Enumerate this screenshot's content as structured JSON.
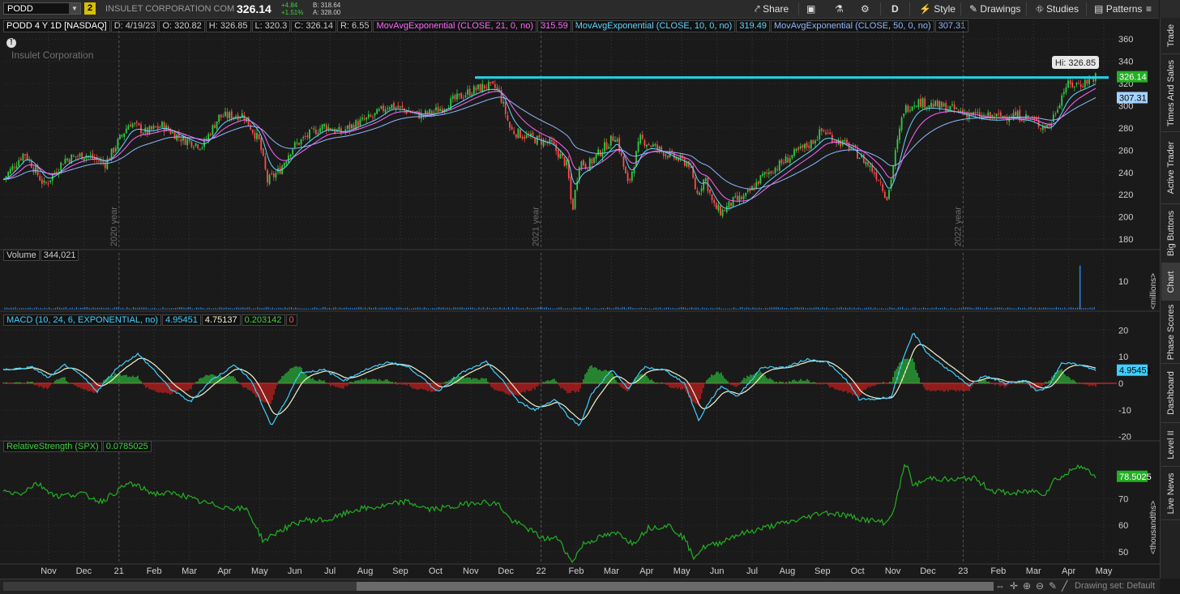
{
  "toolbar": {
    "symbol": "PODD",
    "link_number": "2",
    "company": "INSULET CORPORATION COM",
    "last": "326.14",
    "change": "+4.84",
    "change_pct": "+1.51%",
    "bid": "B: 318.64",
    "ask": "A: 328.00",
    "share": "Share",
    "aggregation": "D",
    "style": "Style",
    "drawings": "Drawings",
    "studies": "Studies",
    "patterns": "Patterns"
  },
  "info": {
    "desc": "PODD 4 Y 1D [NASDAQ]",
    "date": "D: 4/19/23",
    "open": "O: 320.82",
    "high": "H: 326.85",
    "low": "L: 320.3",
    "close": "C: 326.14",
    "range": "R: 6.55",
    "ema21_label": "MovAvgExponential (CLOSE, 21, 0, no)",
    "ema21_val": "315.59",
    "ema10_label": "MovAvgExponential (CLOSE, 10, 0, no)",
    "ema10_val": "319.49",
    "ema50_label": "MovAvgExponential (CLOSE, 50, 0, no)",
    "ema50_val": "307.31",
    "watermark": "Insulet Corporation",
    "alert": "!"
  },
  "volume_label": {
    "name": "Volume",
    "value": "344,021"
  },
  "macd_label": {
    "name": "MACD (10, 24, 6, EXPONENTIAL, no)",
    "value": "4.95451",
    "avg": "4.75137",
    "diff": "0.203142",
    "zero": "0"
  },
  "rs_label": {
    "name": "RelativeStrength (SPX)",
    "value": "0.0785025"
  },
  "sidebar": [
    "Trade",
    "Times And Sales",
    "Active Trader",
    "Big Buttons",
    "Chart",
    "Phase Scores",
    "Dashboard",
    "Level II",
    "Live News"
  ],
  "bottom": {
    "drawing_set": "Drawing set: Default"
  },
  "colors": {
    "candle_up": "#2ecc40",
    "candle_down": "#ff4a4a",
    "ema10": "#5fd7ff",
    "ema21": "#ff66ff",
    "ema50": "#8fb8ff",
    "hline": "#1fd5e6",
    "macd": "#3fd0ff",
    "signal": "#f2f2d0",
    "rs": "#22b022"
  },
  "chart_data": [
    {
      "type": "candlestick",
      "title": "PODD 4 Y 1D [NASDAQ]",
      "x_start": "2019-10",
      "x_end": "2023-04",
      "x_ticks": [
        "Nov",
        "Dec",
        "21",
        "Feb",
        "Mar",
        "Apr",
        "May",
        "Jun",
        "Jul",
        "Aug",
        "Sep",
        "Oct",
        "Nov",
        "Dec",
        "22",
        "Feb",
        "Mar",
        "Apr",
        "May",
        "Jun",
        "Jul",
        "Aug",
        "Sep",
        "Oct",
        "Nov",
        "Dec",
        "23",
        "Feb",
        "Mar",
        "Apr",
        "May"
      ],
      "year_labels": [
        "2020 year",
        "2021 year",
        "2022 year"
      ],
      "y_ticks": [
        180,
        200,
        220,
        240,
        260,
        280,
        300,
        320,
        340,
        360
      ],
      "ylim": [
        172,
        366
      ],
      "close_path": [
        [
          0,
          230
        ],
        [
          30,
          258
        ],
        [
          55,
          228
        ],
        [
          80,
          252
        ],
        [
          105,
          256
        ],
        [
          130,
          248
        ],
        [
          160,
          285
        ],
        [
          180,
          276
        ],
        [
          200,
          282
        ],
        [
          225,
          270
        ],
        [
          250,
          264
        ],
        [
          270,
          290
        ],
        [
          300,
          292
        ],
        [
          320,
          268
        ],
        [
          330,
          232
        ],
        [
          345,
          242
        ],
        [
          360,
          262
        ],
        [
          385,
          276
        ],
        [
          400,
          282
        ],
        [
          420,
          276
        ],
        [
          440,
          284
        ],
        [
          460,
          290
        ],
        [
          480,
          301
        ],
        [
          500,
          296
        ],
        [
          520,
          291
        ],
        [
          540,
          296
        ],
        [
          560,
          305
        ],
        [
          580,
          313
        ],
        [
          600,
          318
        ],
        [
          615,
          315
        ],
        [
          630,
          278
        ],
        [
          650,
          272
        ],
        [
          680,
          266
        ],
        [
          700,
          246
        ],
        [
          706,
          204
        ],
        [
          715,
          250
        ],
        [
          725,
          246
        ],
        [
          745,
          262
        ],
        [
          760,
          274
        ],
        [
          775,
          228
        ],
        [
          790,
          270
        ],
        [
          810,
          262
        ],
        [
          830,
          254
        ],
        [
          850,
          248
        ],
        [
          860,
          220
        ],
        [
          870,
          236
        ],
        [
          880,
          210
        ],
        [
          890,
          204
        ],
        [
          905,
          214
        ],
        [
          920,
          218
        ],
        [
          940,
          236
        ],
        [
          960,
          246
        ],
        [
          975,
          254
        ],
        [
          1000,
          266
        ],
        [
          1015,
          278
        ],
        [
          1030,
          270
        ],
        [
          1050,
          262
        ],
        [
          1070,
          248
        ],
        [
          1085,
          234
        ],
        [
          1095,
          216
        ],
        [
          1105,
          258
        ],
        [
          1115,
          296
        ],
        [
          1130,
          304
        ],
        [
          1150,
          301
        ],
        [
          1170,
          298
        ],
        [
          1190,
          294
        ],
        [
          1210,
          290
        ],
        [
          1230,
          290
        ],
        [
          1250,
          292
        ],
        [
          1270,
          289
        ],
        [
          1285,
          282
        ],
        [
          1295,
          282
        ],
        [
          1305,
          300
        ],
        [
          1315,
          318
        ],
        [
          1335,
          320
        ],
        [
          1352,
          326.14
        ]
      ],
      "resistance": 326.85,
      "hi_label": "Hi: 326.85",
      "last_price": 326.14,
      "ema10_last": 319.49,
      "ema21_last": 315.59,
      "ema50_last": 307.31
    },
    {
      "type": "bar",
      "title": "Volume",
      "y_ticks": [
        10
      ],
      "ylim": [
        0,
        16
      ],
      "unit_label": "<millions>",
      "spike_x_fraction": 0.967,
      "spike_value": 15.5
    },
    {
      "type": "line",
      "title": "MACD (10, 24, 6, EXPONENTIAL, no)",
      "y_ticks": [
        -20,
        -10,
        0,
        10,
        20
      ],
      "ylim": [
        -21,
        21
      ],
      "macd_path": [
        [
          0,
          5
        ],
        [
          40,
          6
        ],
        [
          60,
          2
        ],
        [
          80,
          7
        ],
        [
          100,
          3
        ],
        [
          120,
          -3
        ],
        [
          145,
          6
        ],
        [
          170,
          11
        ],
        [
          190,
          5
        ],
        [
          210,
          -2
        ],
        [
          235,
          -7
        ],
        [
          260,
          1
        ],
        [
          290,
          7
        ],
        [
          310,
          1
        ],
        [
          322,
          -7
        ],
        [
          335,
          -16
        ],
        [
          350,
          -8
        ],
        [
          370,
          4
        ],
        [
          400,
          5
        ],
        [
          425,
          1
        ],
        [
          450,
          5
        ],
        [
          480,
          8
        ],
        [
          505,
          6
        ],
        [
          540,
          -3
        ],
        [
          570,
          4
        ],
        [
          600,
          8
        ],
        [
          620,
          1
        ],
        [
          640,
          -7
        ],
        [
          660,
          -10
        ],
        [
          685,
          -6
        ],
        [
          700,
          -12
        ],
        [
          715,
          -16
        ],
        [
          730,
          -4
        ],
        [
          755,
          5
        ],
        [
          775,
          -2
        ],
        [
          795,
          6
        ],
        [
          820,
          5
        ],
        [
          845,
          0
        ],
        [
          862,
          -14
        ],
        [
          875,
          -7
        ],
        [
          890,
          -1
        ],
        [
          910,
          -5
        ],
        [
          940,
          6
        ],
        [
          970,
          6
        ],
        [
          995,
          9
        ],
        [
          1020,
          8
        ],
        [
          1045,
          1
        ],
        [
          1060,
          -6
        ],
        [
          1080,
          -6
        ],
        [
          1100,
          -5
        ],
        [
          1112,
          7
        ],
        [
          1127,
          19
        ],
        [
          1145,
          11
        ],
        [
          1175,
          4
        ],
        [
          1195,
          -1
        ],
        [
          1215,
          3
        ],
        [
          1240,
          0
        ],
        [
          1265,
          1
        ],
        [
          1280,
          -3
        ],
        [
          1295,
          -1
        ],
        [
          1310,
          8
        ],
        [
          1330,
          7
        ],
        [
          1352,
          4.95
        ]
      ],
      "macd_last": 4.95451
    },
    {
      "type": "line",
      "title": "RelativeStrength (SPX)",
      "y_ticks": [
        50,
        60,
        70
      ],
      "ylim": [
        46,
        87
      ],
      "unit_label": "<thousandths>",
      "rs_path": [
        [
          0,
          73
        ],
        [
          25,
          72
        ],
        [
          45,
          76
        ],
        [
          70,
          71
        ],
        [
          100,
          72
        ],
        [
          125,
          69
        ],
        [
          160,
          76
        ],
        [
          190,
          72
        ],
        [
          220,
          72
        ],
        [
          245,
          69
        ],
        [
          275,
          67
        ],
        [
          305,
          66
        ],
        [
          315,
          60
        ],
        [
          325,
          54
        ],
        [
          345,
          58
        ],
        [
          375,
          62
        ],
        [
          405,
          62
        ],
        [
          440,
          66
        ],
        [
          470,
          67
        ],
        [
          500,
          69
        ],
        [
          530,
          66
        ],
        [
          560,
          67
        ],
        [
          590,
          69
        ],
        [
          615,
          68
        ],
        [
          630,
          62
        ],
        [
          650,
          59
        ],
        [
          670,
          55
        ],
        [
          690,
          55
        ],
        [
          705,
          46
        ],
        [
          720,
          53
        ],
        [
          745,
          56
        ],
        [
          765,
          57
        ],
        [
          780,
          53
        ],
        [
          800,
          59
        ],
        [
          825,
          60
        ],
        [
          845,
          55
        ],
        [
          855,
          48
        ],
        [
          870,
          52
        ],
        [
          885,
          53
        ],
        [
          905,
          56
        ],
        [
          930,
          58
        ],
        [
          955,
          60
        ],
        [
          985,
          62
        ],
        [
          1015,
          65
        ],
        [
          1040,
          64
        ],
        [
          1070,
          62
        ],
        [
          1095,
          61
        ],
        [
          1105,
          68
        ],
        [
          1117,
          84
        ],
        [
          1127,
          75
        ],
        [
          1150,
          78
        ],
        [
          1175,
          77
        ],
        [
          1200,
          78
        ],
        [
          1225,
          73
        ],
        [
          1250,
          72
        ],
        [
          1275,
          73
        ],
        [
          1290,
          72
        ],
        [
          1300,
          77
        ],
        [
          1315,
          79
        ],
        [
          1330,
          83
        ],
        [
          1352,
          78.5
        ]
      ],
      "rs_last": "78.5025"
    }
  ]
}
